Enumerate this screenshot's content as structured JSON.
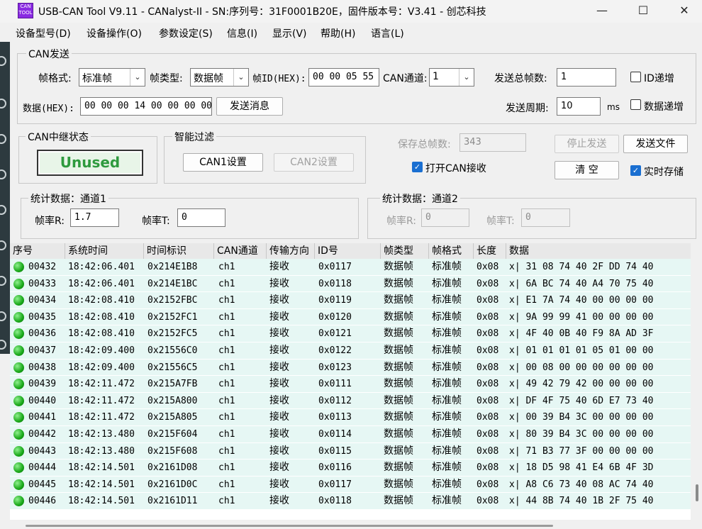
{
  "window": {
    "icon_text": "CAN TOOL",
    "title": "USB-CAN Tool V9.11 - CANalyst-II - SN:序列号：31F0001B20E，固件版本号：V3.41 - 创芯科技",
    "controls": [
      "—",
      "☐",
      "✕"
    ]
  },
  "menu": [
    "设备型号(D)",
    "设备操作(O)",
    "参数设定(S)",
    "信息(I)",
    "显示(V)",
    "帮助(H)",
    "语言(L)"
  ],
  "can_send": {
    "group_label": "CAN发送",
    "frame_format_label": "帧格式:",
    "frame_format_value": "标准帧",
    "frame_type_label": "帧类型:",
    "frame_type_value": "数据帧",
    "frame_id_label": "帧ID(HEX):",
    "frame_id_value": "00 00 05 55",
    "can_channel_label": "CAN通道:",
    "can_channel_value": "1",
    "total_frames_label": "发送总帧数:",
    "total_frames_value": "1",
    "id_increment_label": "ID递增",
    "data_label": "数据(HEX):",
    "data_value": "00 00 00 14 00 00 00 00",
    "send_button": "发送消息",
    "period_label": "发送周期:",
    "period_value": "10",
    "period_unit": "ms",
    "data_increment_label": "数据递增"
  },
  "relay": {
    "group_label": "CAN中继状态",
    "status": "Unused"
  },
  "filter": {
    "group_label": "智能过滤",
    "can1_button": "CAN1设置",
    "can2_button": "CAN2设置"
  },
  "controls": {
    "saved_frames_label": "保存总帧数:",
    "saved_frames_value": "343",
    "open_can_receive_label": "打开CAN接收",
    "stop_send_button": "停止发送",
    "send_file_button": "发送文件",
    "clear_button": "清 空",
    "realtime_save_label": "实时存储"
  },
  "stats1": {
    "group_label": "统计数据：通道1",
    "rate_r_label": "帧率R:",
    "rate_r_value": "1.7",
    "rate_t_label": "帧率T:",
    "rate_t_value": "0"
  },
  "stats2": {
    "group_label": "统计数据：通道2",
    "rate_r_label": "帧率R:",
    "rate_r_value": "0",
    "rate_t_label": "帧率T:",
    "rate_t_value": "0"
  },
  "table": {
    "columns": [
      "序号",
      "系统时间",
      "时间标识",
      "CAN通道",
      "传输方向",
      "ID号",
      "帧类型",
      "帧格式",
      "长度",
      "数据"
    ],
    "rows": [
      [
        "00432",
        "18:42:06.401",
        "0x214E1B8",
        "ch1",
        "接收",
        "0x0117",
        "数据帧",
        "标准帧",
        "0x08",
        "x| 31 08 74 40 2F DD 74 40"
      ],
      [
        "00433",
        "18:42:06.401",
        "0x214E1BC",
        "ch1",
        "接收",
        "0x0118",
        "数据帧",
        "标准帧",
        "0x08",
        "x| 6A BC 74 40 A4 70 75 40"
      ],
      [
        "00434",
        "18:42:08.410",
        "0x2152FBC",
        "ch1",
        "接收",
        "0x0119",
        "数据帧",
        "标准帧",
        "0x08",
        "x| E1 7A 74 40 00 00 00 00"
      ],
      [
        "00435",
        "18:42:08.410",
        "0x2152FC1",
        "ch1",
        "接收",
        "0x0120",
        "数据帧",
        "标准帧",
        "0x08",
        "x| 9A 99 99 41 00 00 00 00"
      ],
      [
        "00436",
        "18:42:08.410",
        "0x2152FC5",
        "ch1",
        "接收",
        "0x0121",
        "数据帧",
        "标准帧",
        "0x08",
        "x| 4F 40 0B 40 F9 8A AD 3F"
      ],
      [
        "00437",
        "18:42:09.400",
        "0x21556C0",
        "ch1",
        "接收",
        "0x0122",
        "数据帧",
        "标准帧",
        "0x08",
        "x| 01 01 01 01 05 01 00 00"
      ],
      [
        "00438",
        "18:42:09.400",
        "0x21556C5",
        "ch1",
        "接收",
        "0x0123",
        "数据帧",
        "标准帧",
        "0x08",
        "x| 00 08 00 00 00 00 00 00"
      ],
      [
        "00439",
        "18:42:11.472",
        "0x215A7FB",
        "ch1",
        "接收",
        "0x0111",
        "数据帧",
        "标准帧",
        "0x08",
        "x| 49 42 79 42 00 00 00 00"
      ],
      [
        "00440",
        "18:42:11.472",
        "0x215A800",
        "ch1",
        "接收",
        "0x0112",
        "数据帧",
        "标准帧",
        "0x08",
        "x| DF 4F 75 40 6D E7 73 40"
      ],
      [
        "00441",
        "18:42:11.472",
        "0x215A805",
        "ch1",
        "接收",
        "0x0113",
        "数据帧",
        "标准帧",
        "0x08",
        "x| 00 39 B4 3C 00 00 00 00"
      ],
      [
        "00442",
        "18:42:13.480",
        "0x215F604",
        "ch1",
        "接收",
        "0x0114",
        "数据帧",
        "标准帧",
        "0x08",
        "x| 80 39 B4 3C 00 00 00 00"
      ],
      [
        "00443",
        "18:42:13.480",
        "0x215F608",
        "ch1",
        "接收",
        "0x0115",
        "数据帧",
        "标准帧",
        "0x08",
        "x| 71 B3 77 3F 00 00 00 00"
      ],
      [
        "00444",
        "18:42:14.501",
        "0x2161D08",
        "ch1",
        "接收",
        "0x0116",
        "数据帧",
        "标准帧",
        "0x08",
        "x| 18 D5 98 41 E4 6B 4F 3D"
      ],
      [
        "00445",
        "18:42:14.501",
        "0x2161D0C",
        "ch1",
        "接收",
        "0x0117",
        "数据帧",
        "标准帧",
        "0x08",
        "x| A8 C6 73 40 08 AC 74 40"
      ],
      [
        "00446",
        "18:42:14.501",
        "0x2161D11",
        "ch1",
        "接收",
        "0x0118",
        "数据帧",
        "标准帧",
        "0x08",
        "x| 44 8B 74 40 1B 2F 75 40"
      ]
    ]
  }
}
